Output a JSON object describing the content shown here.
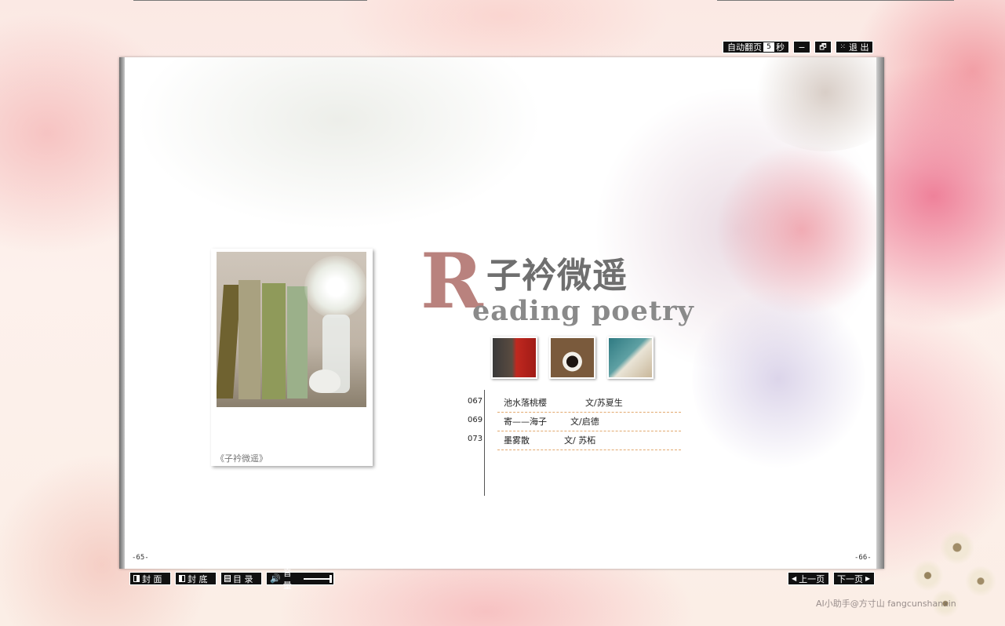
{
  "toolbar": {
    "auto_flip_label": "自动翻页",
    "auto_flip_seconds": "5",
    "seconds_unit": "秒",
    "minimize_label": "−",
    "restore_label": "🗗",
    "exit_label": "退 出"
  },
  "page": {
    "left_number": "-65-",
    "right_number": "-66-",
    "photo_caption": "《子衿微遥》",
    "header_initial": "R",
    "header_title": "子衿微遥",
    "header_subtitle": "eading poetry"
  },
  "toc": [
    {
      "num": "067",
      "title": "池水落桃樱",
      "author": "文/苏夏生"
    },
    {
      "num": "069",
      "title": "寄——海子",
      "author": "文/启德"
    },
    {
      "num": "073",
      "title": "墨雾散",
      "author": "文/ 苏柘"
    }
  ],
  "bottom_bar": {
    "cover_label": "封 面",
    "back_cover_label": "封 底",
    "contents_label": "目 录",
    "volume_label": "音量",
    "prev_label": "上一页",
    "next_label": "下一页"
  },
  "watermark": "AI小助手@方寸山  fangcunshanxin",
  "colors": {
    "accent_red": "#b9827e",
    "title_gray": "#6f6f6f",
    "dash_orange": "#e2a96f"
  }
}
